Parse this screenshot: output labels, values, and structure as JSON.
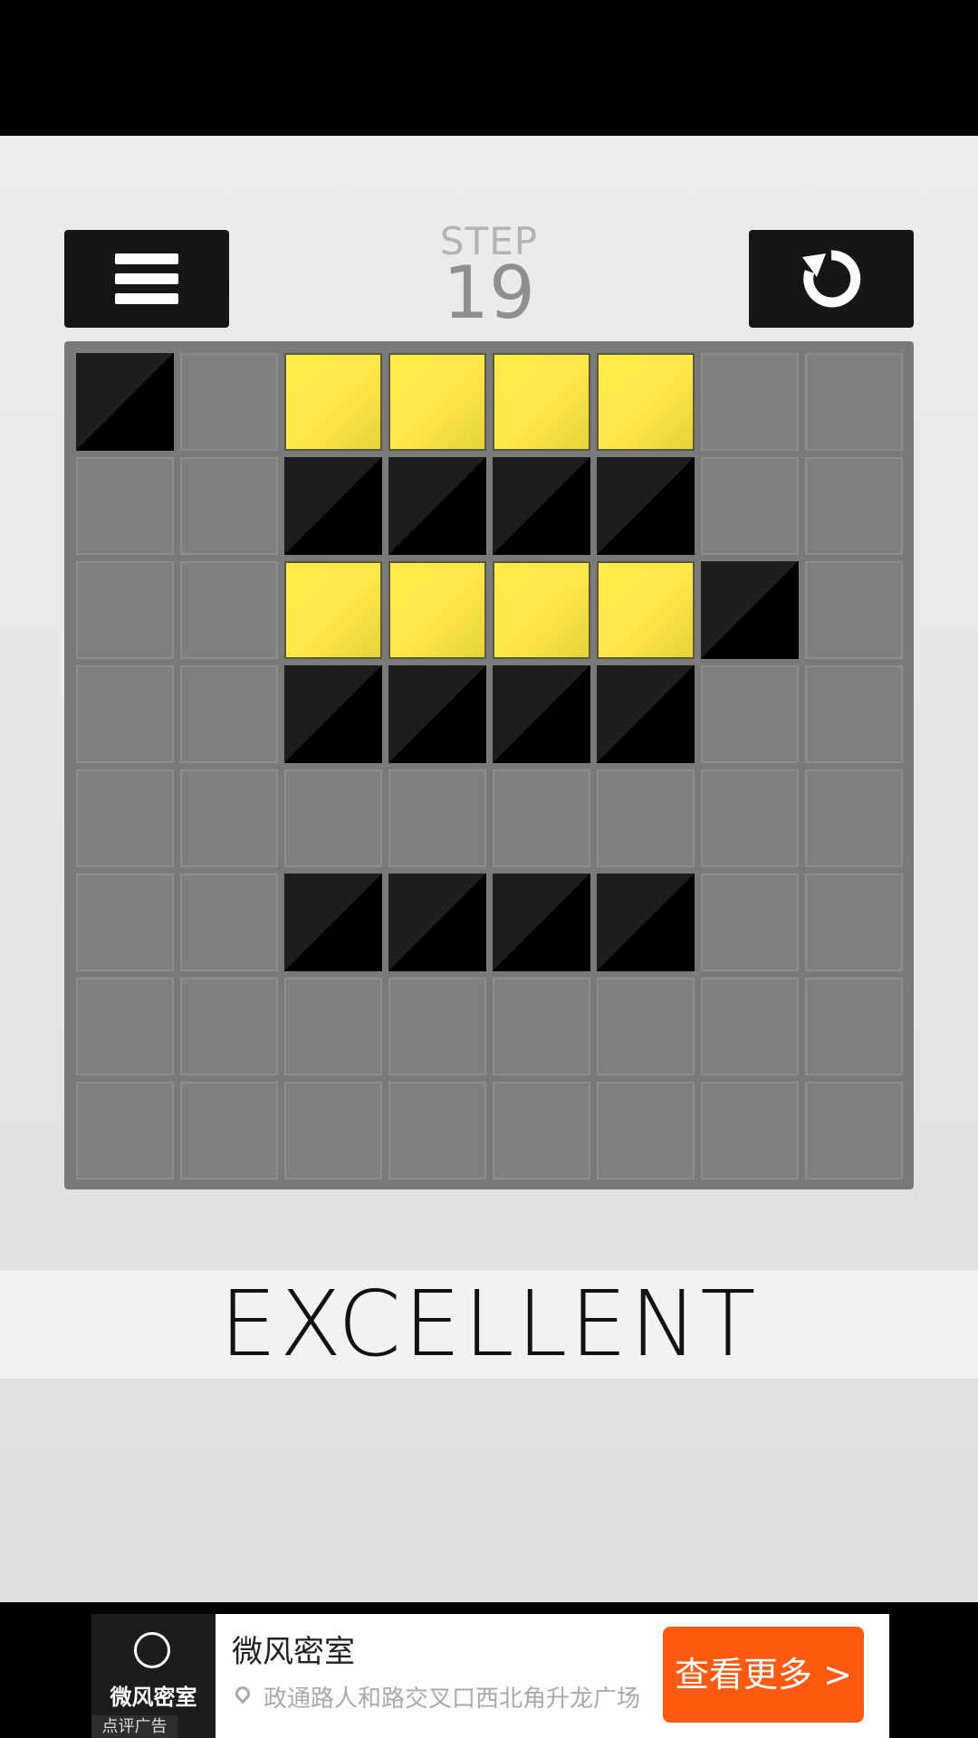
{
  "header": {
    "step_label": "STEP",
    "step_count": "19",
    "menu_icon": "hamburger-menu-icon",
    "restart_icon": "restart-arrow-icon"
  },
  "board": {
    "rows": 8,
    "cols": 8,
    "cells": [
      [
        "black",
        "empty",
        "yellow",
        "yellow",
        "yellow",
        "yellow",
        "empty",
        "empty"
      ],
      [
        "empty",
        "empty",
        "black",
        "black",
        "black",
        "black",
        "empty",
        "empty"
      ],
      [
        "empty",
        "empty",
        "yellow",
        "yellow",
        "yellow",
        "yellow",
        "black",
        "empty"
      ],
      [
        "empty",
        "empty",
        "black",
        "black",
        "black",
        "black",
        "empty",
        "empty"
      ],
      [
        "empty",
        "empty",
        "empty",
        "empty",
        "empty",
        "empty",
        "empty",
        "empty"
      ],
      [
        "empty",
        "empty",
        "black",
        "black",
        "black",
        "black",
        "empty",
        "empty"
      ],
      [
        "empty",
        "empty",
        "empty",
        "empty",
        "empty",
        "empty",
        "empty",
        "empty"
      ],
      [
        "empty",
        "empty",
        "empty",
        "empty",
        "empty",
        "empty",
        "empty",
        "empty"
      ]
    ],
    "colors": {
      "yellow": "#ffe84a",
      "black": "#000000",
      "empty": "#7f7f7f"
    }
  },
  "result": {
    "text": "EXCELLENT"
  },
  "ad": {
    "logo_text": "微风密室",
    "tag": "点评广告",
    "title": "微风密室",
    "address": "政通路人和路交叉口西北角升龙广场",
    "cta": "查看更多 >",
    "cta_color": "#ff5a11"
  }
}
